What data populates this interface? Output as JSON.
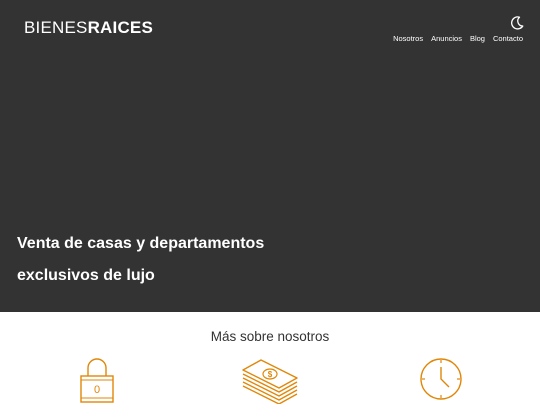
{
  "header": {
    "logo_light": "BIENES",
    "logo_bold": "RAICES",
    "theme_icon": "moon-icon",
    "nav": [
      "Nosotros",
      "Anuncios",
      "Blog",
      "Contacto"
    ]
  },
  "hero": {
    "title_line1": "Venta de casas y departamentos",
    "title_line2": "exclusivos de lujo"
  },
  "about": {
    "title": "Más sobre nosotros",
    "icons": [
      "lock-icon",
      "money-icon",
      "clock-icon"
    ],
    "lock_digit": "0"
  },
  "colors": {
    "hero_bg": "#333333",
    "accent": "#e08709"
  }
}
